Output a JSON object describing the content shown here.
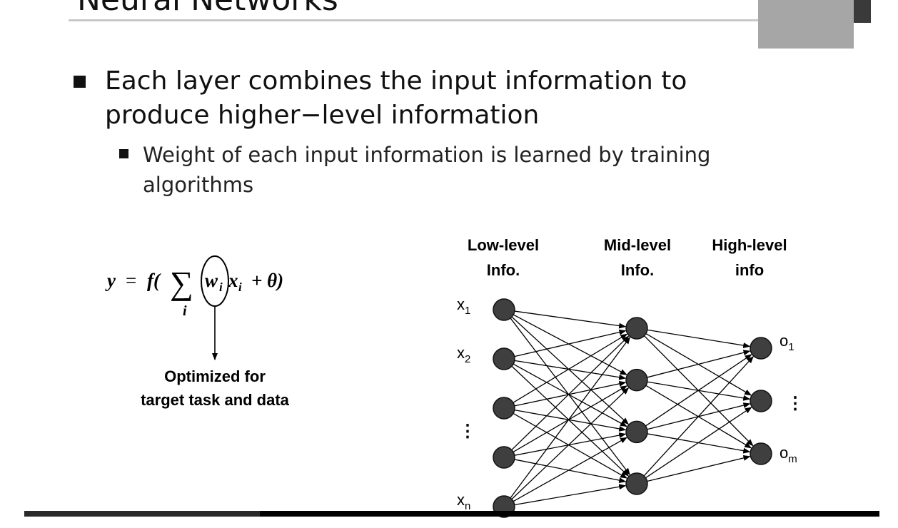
{
  "slide": {
    "title": "Neural Networks",
    "bullet_main": "Each layer combines the input information to produce higher−level information",
    "bullet_sub": "Weight of each input information is learned by training algorithms"
  },
  "formula": {
    "lhs": "y",
    "equals": "=",
    "f": "f(",
    "sigma": "∑",
    "index": "i",
    "w": "w",
    "w_sub": "i",
    "x": "x",
    "x_sub": "i",
    "plus_theta": "+ θ)",
    "caption_line1": "Optimized for",
    "caption_line2": "target task and data"
  },
  "network": {
    "headers": {
      "low_line1": "Low-level",
      "low_line2": "Info.",
      "mid_line1": "Mid-level",
      "mid_line2": "Info.",
      "high_line1": "High-level",
      "high_line2": "info"
    },
    "inputs": [
      {
        "name": "x",
        "sub": "1"
      },
      {
        "name": "x",
        "sub": "2"
      },
      {
        "name": "x",
        "sub": "n"
      }
    ],
    "outputs": [
      {
        "name": "o",
        "sub": "1"
      },
      {
        "name": "o",
        "sub": "m"
      }
    ],
    "ellipsis": "⋮",
    "input_layer_nodes": 5,
    "hidden_layer_nodes": 4,
    "output_layer_nodes": 3,
    "node_color": "#3f3f3f"
  }
}
